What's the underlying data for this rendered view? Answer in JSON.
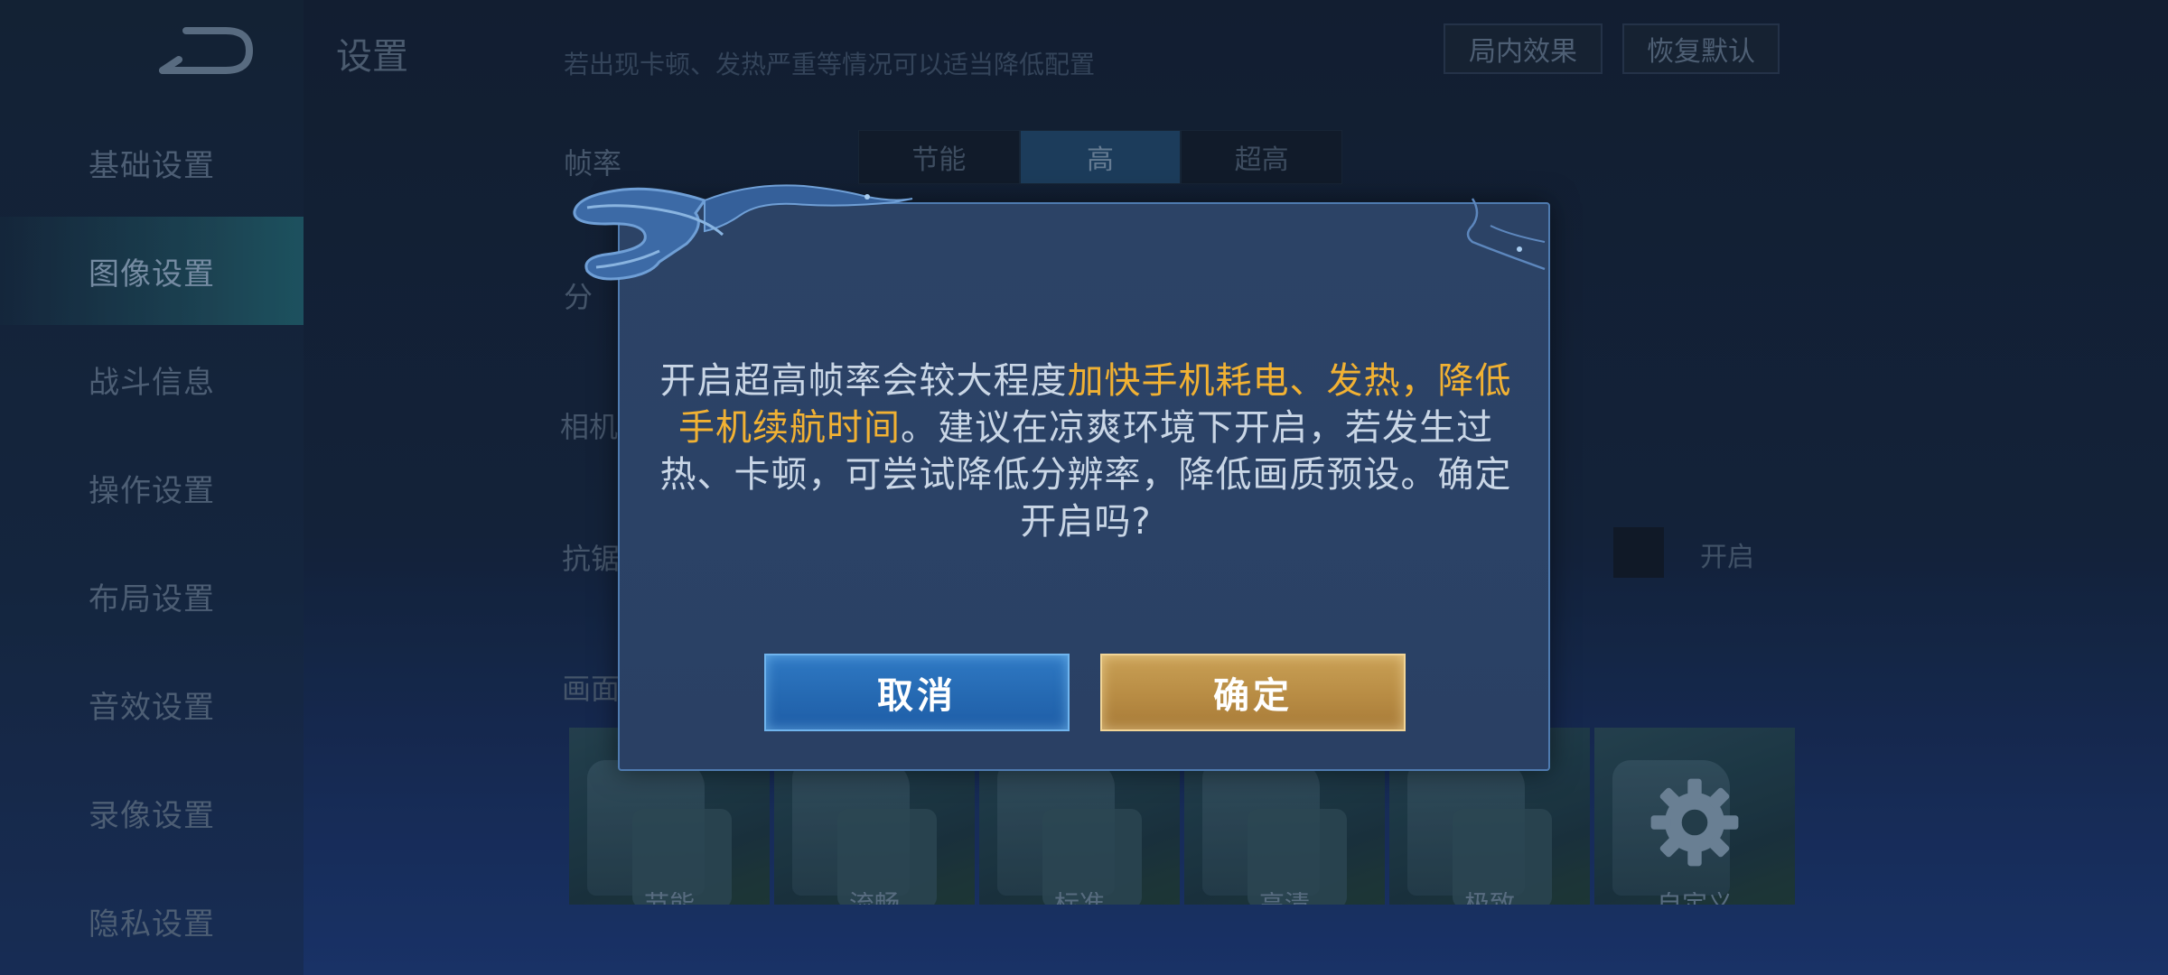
{
  "sidebar": {
    "items": [
      {
        "label": "基础设置"
      },
      {
        "label": "图像设置"
      },
      {
        "label": "战斗信息"
      },
      {
        "label": "操作设置"
      },
      {
        "label": "布局设置"
      },
      {
        "label": "音效设置"
      },
      {
        "label": "录像设置"
      },
      {
        "label": "隐私设置"
      }
    ],
    "active_index": 1
  },
  "header": {
    "title": "设置",
    "hint": "若出现卡顿、发热严重等情况可以适当降低配置",
    "buttons": {
      "in_game_effect": "局内效果",
      "restore_default": "恢复默认"
    }
  },
  "settings": {
    "frame_rate": {
      "label": "帧率",
      "options": [
        "节能",
        "高",
        "超高"
      ],
      "selected": "高"
    },
    "resolution": {
      "label_partial": "分"
    },
    "camera": {
      "label_partial": "相机"
    },
    "anti_aliasing": {
      "label_partial": "抗锯",
      "toggle_label": "开启"
    },
    "quality": {
      "label_partial": "画面",
      "presets": [
        "节能",
        "流畅",
        "标准",
        "高清",
        "极致",
        "自定义"
      ]
    }
  },
  "dialog": {
    "message": {
      "part1": "开启超高帧率会较大程度",
      "highlight": "加快手机耗电、发热，降低手机续航时间",
      "part2": "。建议在凉爽环境下开启，若发生过热、卡顿，可尝试降低分辨率，降低画质预设。确定开启吗?"
    },
    "cancel_label": "取消",
    "confirm_label": "确定"
  },
  "colors": {
    "highlight": "#f1b133",
    "cancel_button": "#2569b2",
    "confirm_button": "#b88c44",
    "dialog_bg": "#2c4366"
  },
  "icons": {
    "back": "back-arrow-icon",
    "custom_preset": "gear-icon"
  }
}
